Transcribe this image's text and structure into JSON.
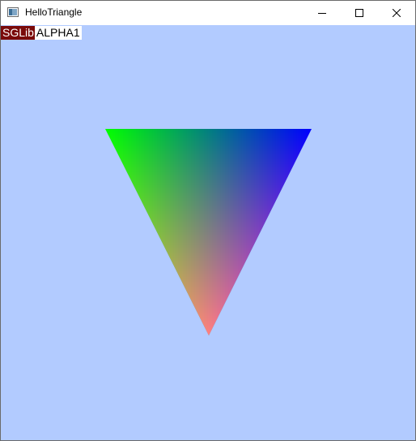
{
  "window": {
    "title": "HelloTriangle",
    "controls": {
      "minimize": "minimize-icon",
      "maximize": "maximize-icon",
      "close": "close-icon"
    }
  },
  "overlay": {
    "library": "SGLib",
    "version": "ALPHA1"
  },
  "colors": {
    "background": "#b2cbff",
    "badge_library_bg": "#7a0a0a",
    "badge_version_bg": "#ffffff",
    "vertex_left": "#00ff00",
    "vertex_right": "#0000ff",
    "vertex_bottom": "#ff0000"
  }
}
